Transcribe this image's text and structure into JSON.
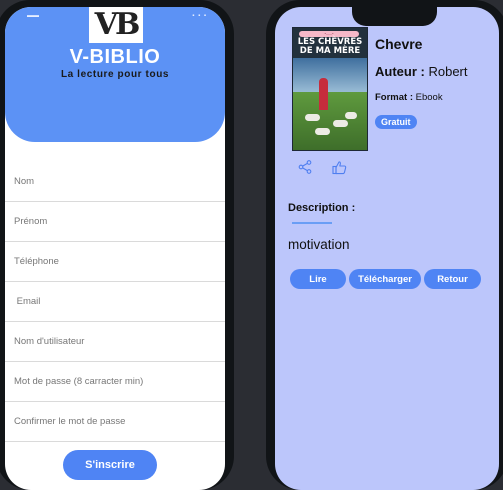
{
  "colors": {
    "brand_blue": "#5c92f5",
    "button_blue": "#4f84f4",
    "detail_background": "#bcc6fb"
  },
  "register_screen": {
    "logo_mark": "VB",
    "app_name": "V-BIBLIO",
    "tagline": "La lecture pour tous",
    "fields": [
      {
        "placeholder": "Nom"
      },
      {
        "placeholder": "Prénom"
      },
      {
        "placeholder": "Téléphone"
      },
      {
        "placeholder": " Email"
      },
      {
        "placeholder": "Nom d'utilisateur"
      },
      {
        "placeholder": "Mot de passe (8 carracter min)"
      },
      {
        "placeholder": "Confirmer le mot de passe"
      }
    ],
    "submit_label": "S'inscrire"
  },
  "book_detail_screen": {
    "poster": {
      "title_line1": "LES CHÈVRES",
      "title_line2": "DE MA MÈRE"
    },
    "title": "Chevre",
    "author_label": "Auteur :",
    "author": "Robert",
    "format_label": "Format :",
    "format": "Ebook",
    "badge": "Gratuit",
    "icons": [
      "share-icon",
      "thumbs-up-icon"
    ],
    "description_label": "Description :",
    "description": "motivation",
    "buttons": {
      "read": "Lire",
      "download": "Télécharger",
      "back": "Retour"
    }
  }
}
